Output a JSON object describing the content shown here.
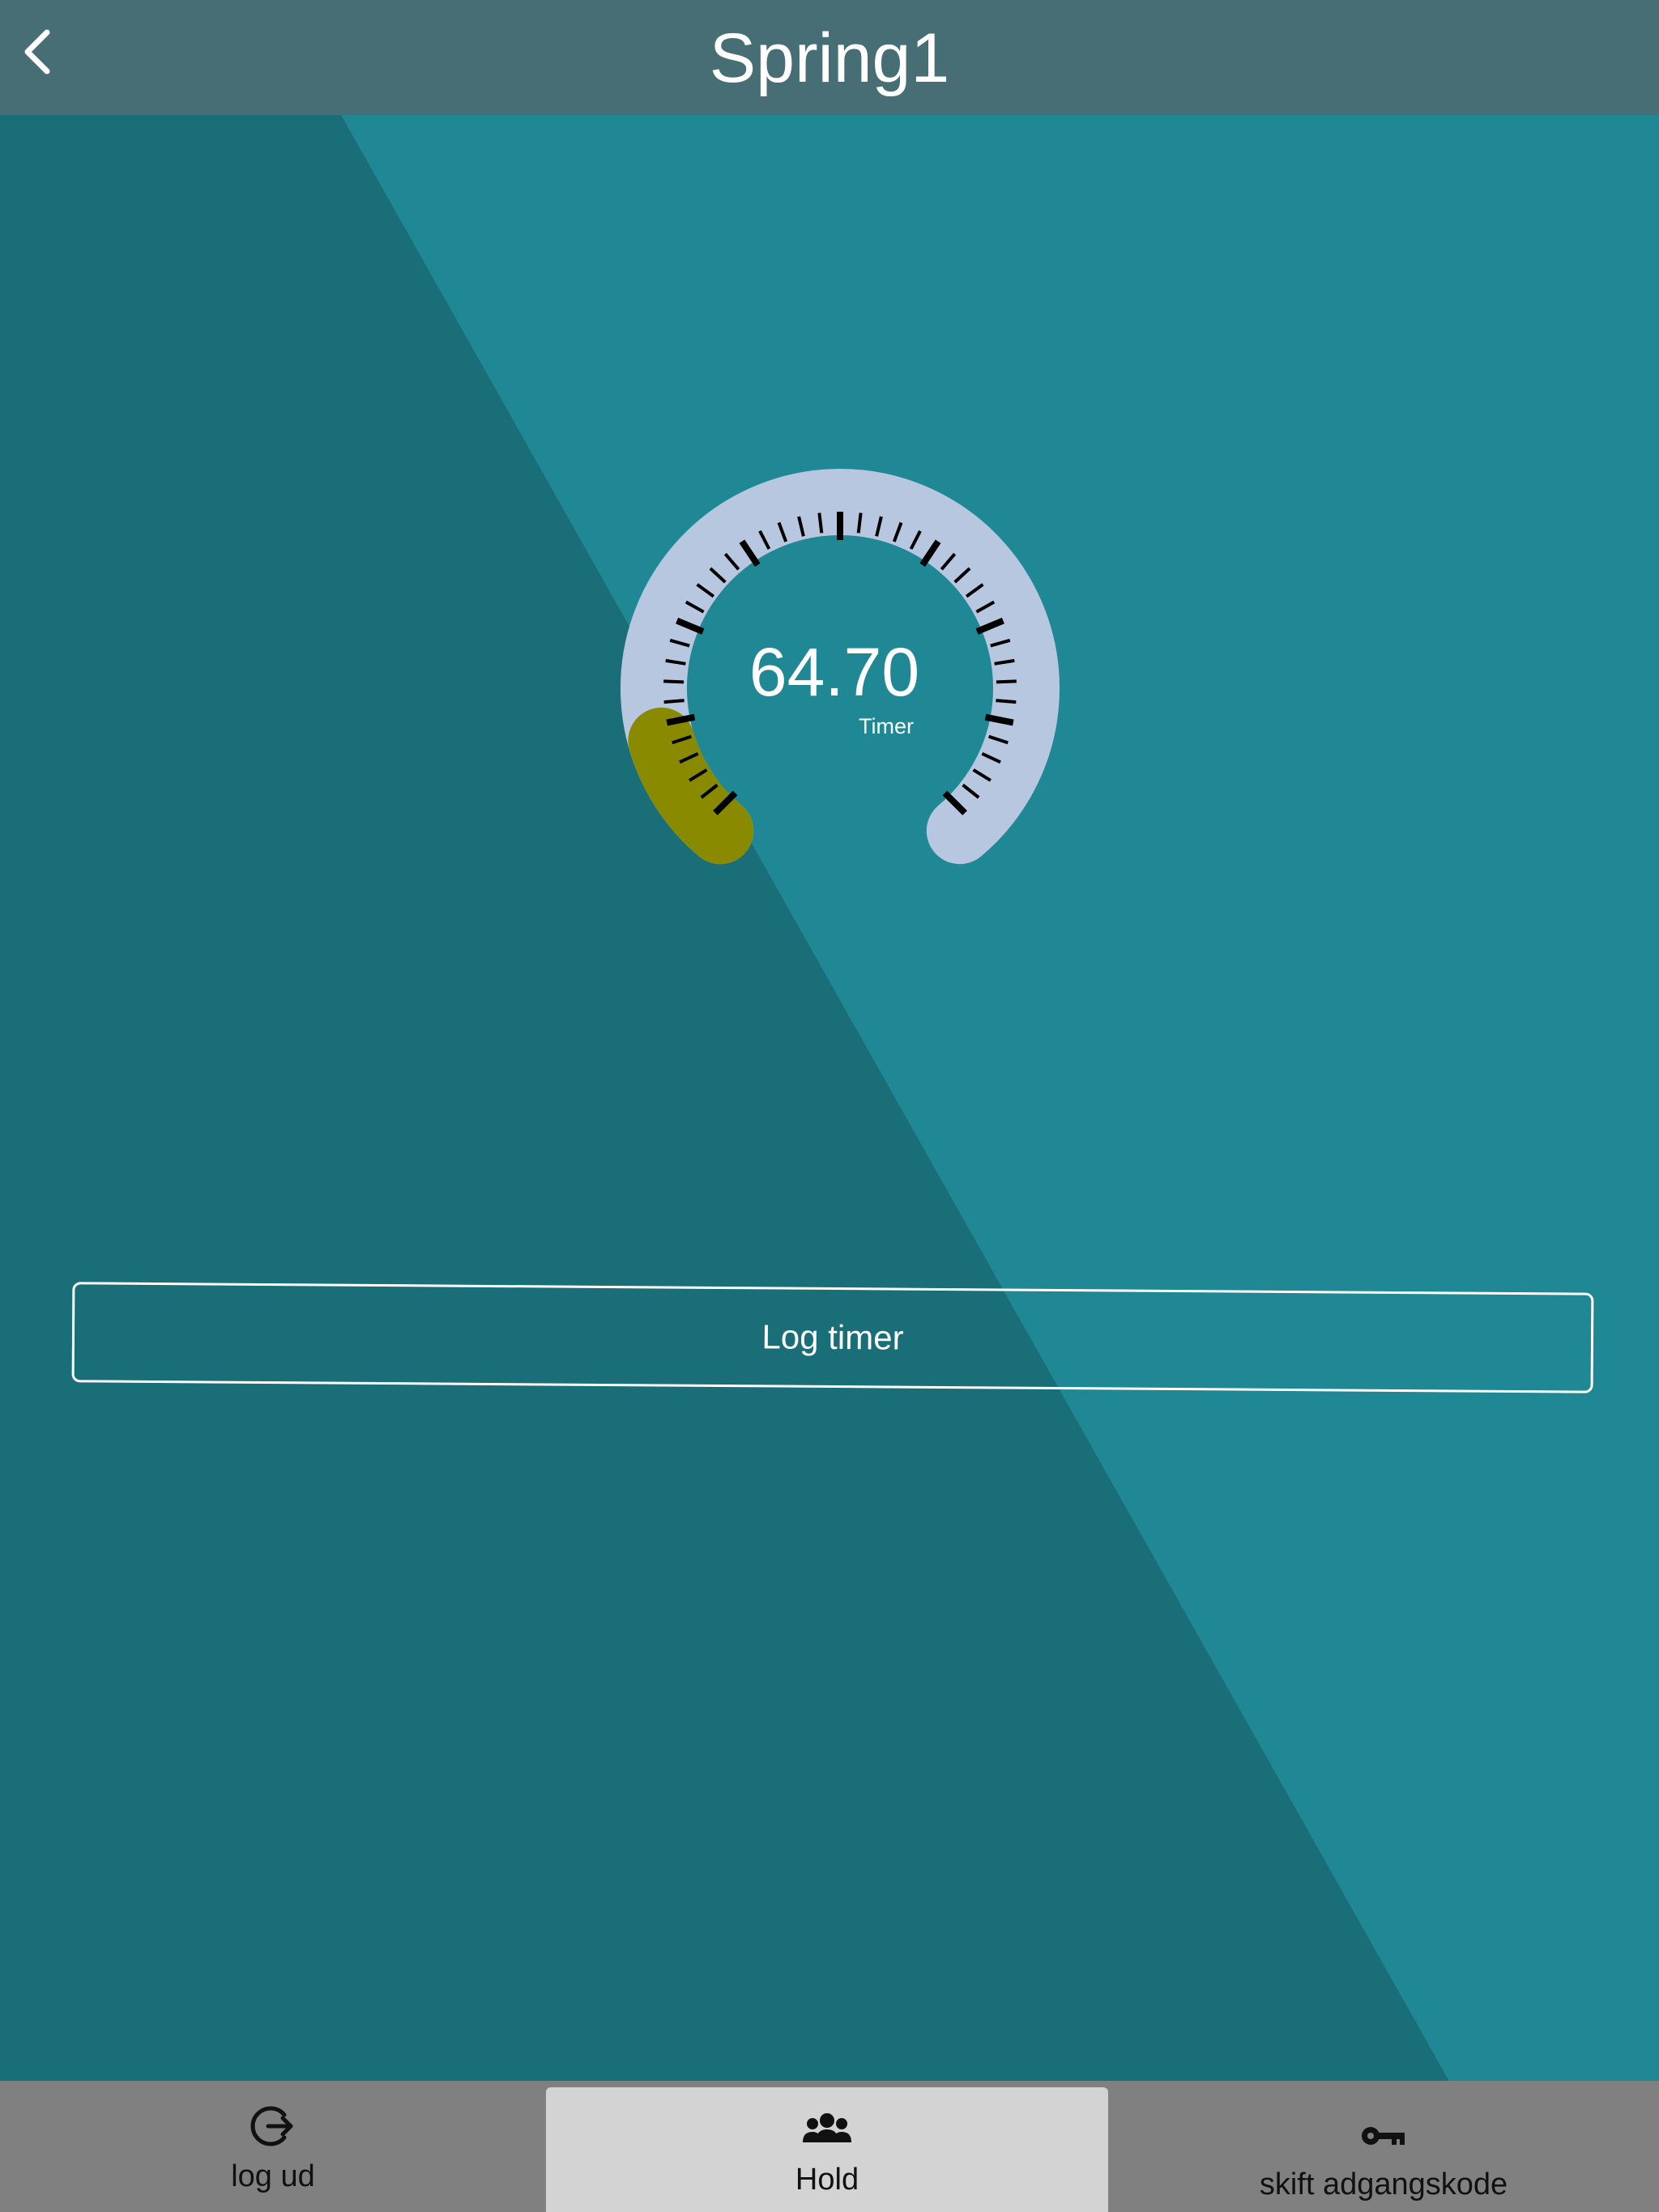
{
  "header": {
    "title": "Spring1",
    "back_icon": "chevron-left-icon"
  },
  "gauge": {
    "value": "64.70",
    "label": "Timer",
    "fill_fraction": 0.12,
    "colors": {
      "track": "#b7c7e0",
      "fill": "#8a8a00",
      "ticks": "#000000"
    }
  },
  "actions": {
    "log_timer_label": "Log timer"
  },
  "tab_bar": {
    "tabs": [
      {
        "label": "log ud",
        "icon": "logout-icon",
        "selected": false
      },
      {
        "label": "Hold",
        "icon": "group-icon",
        "selected": true
      },
      {
        "label": "skift adgangskode",
        "icon": "key-icon",
        "selected": false
      }
    ]
  },
  "theme": {
    "background_dark": "#1a6e78",
    "background_light": "#1f8894",
    "header": "#466e74",
    "tab_bar": "#808080",
    "tab_selected": "#d3d3d3"
  }
}
